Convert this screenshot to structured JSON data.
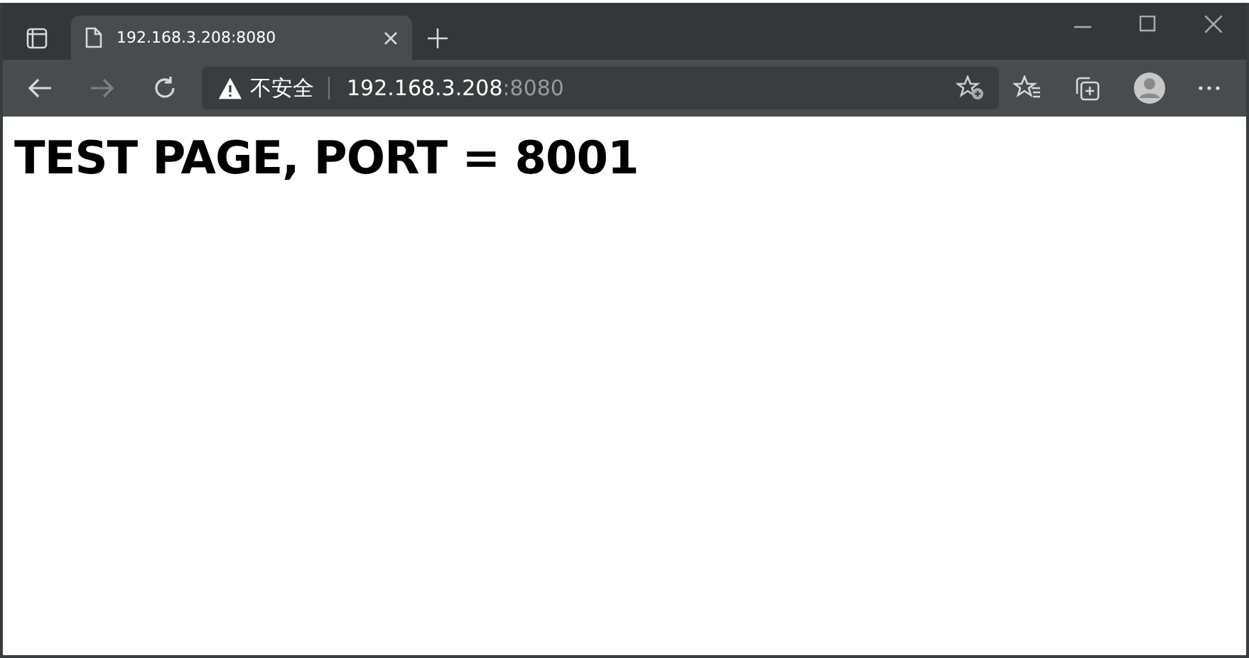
{
  "tabs": [
    {
      "title": "192.168.3.208:8080",
      "selected": true
    }
  ],
  "address_bar": {
    "security_label": "不安全",
    "host": "192.168.3.208",
    "port": ":8080"
  },
  "page": {
    "heading": "TEST PAGE, PORT = 8001"
  }
}
